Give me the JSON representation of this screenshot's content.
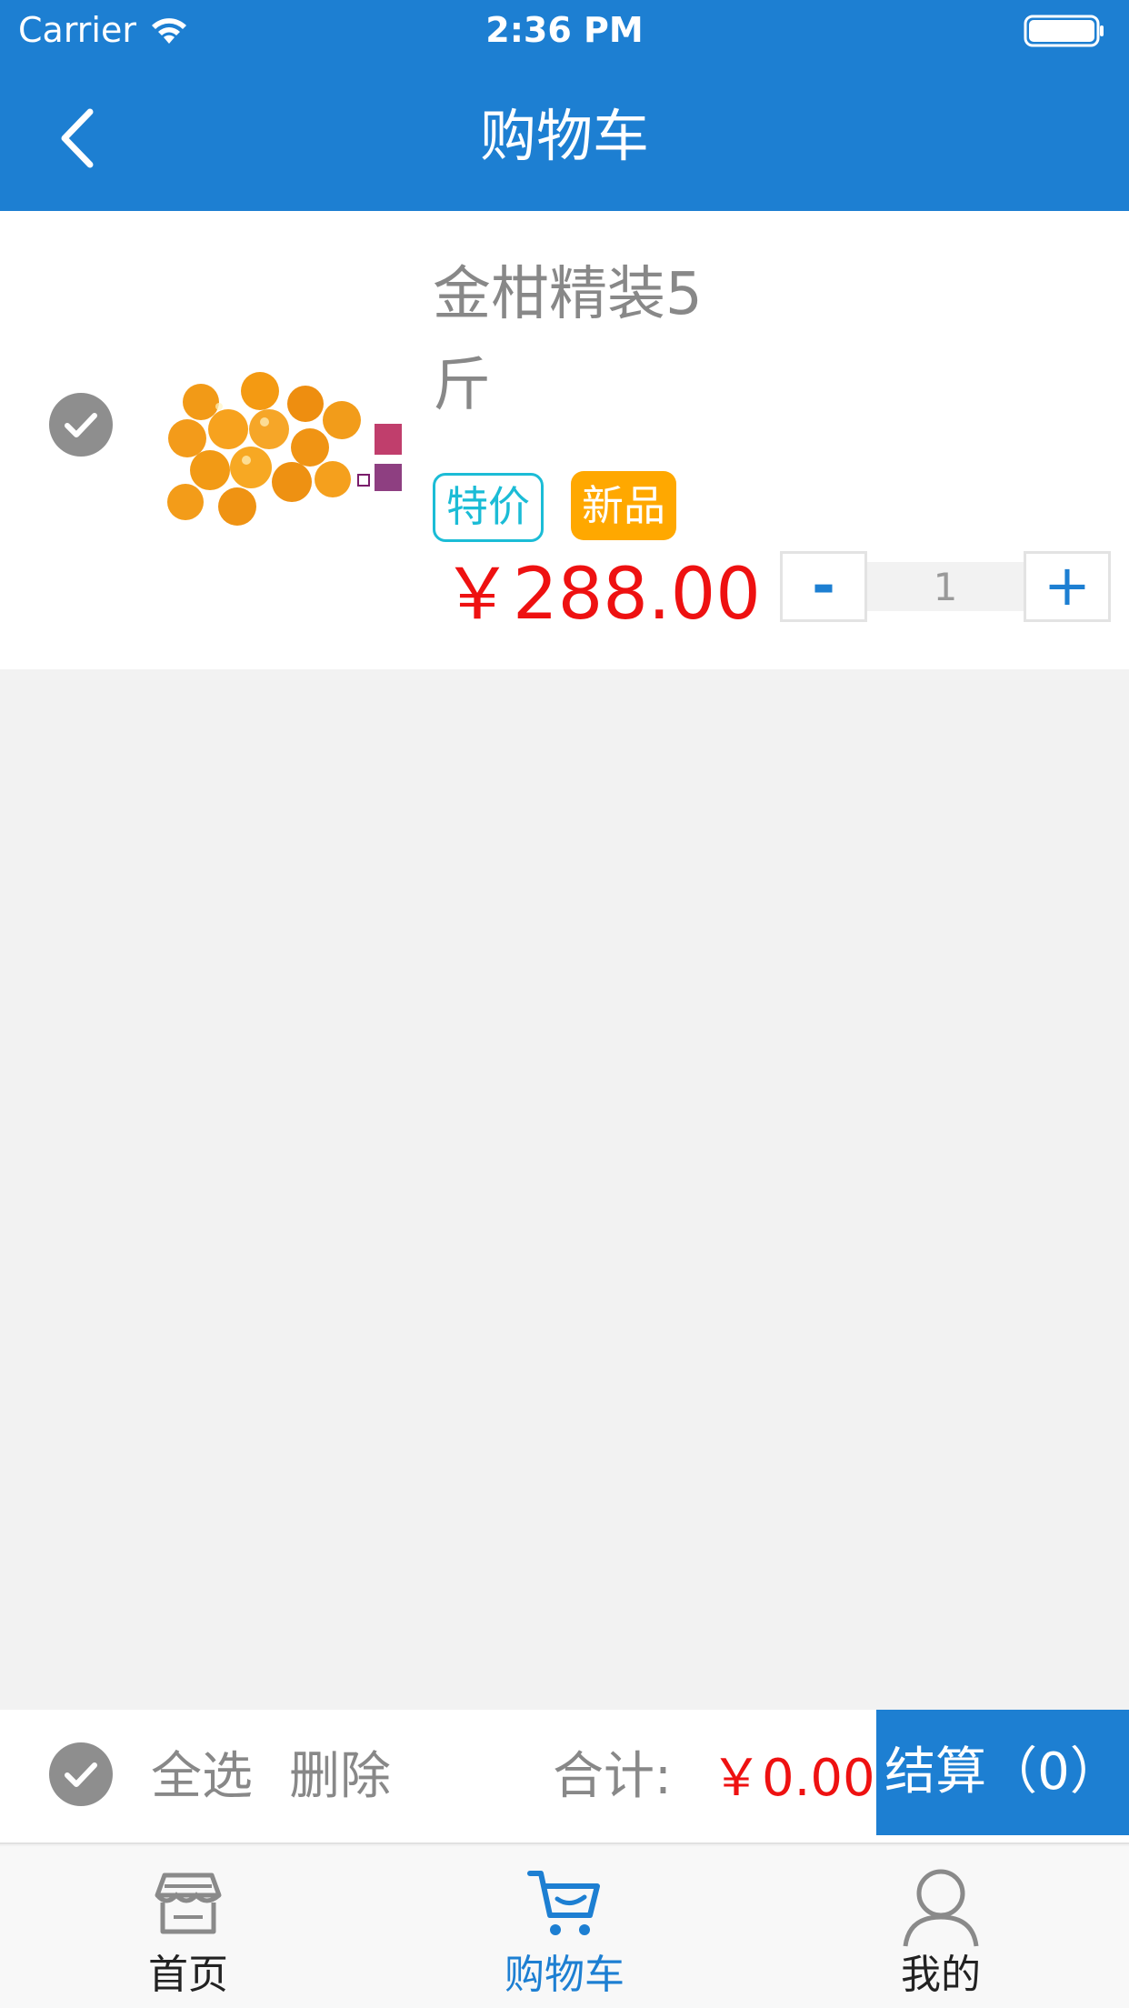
{
  "status_bar": {
    "carrier": "Carrier",
    "time": "2:36 PM"
  },
  "nav": {
    "title": "购物车",
    "back_icon": "chevron-left-icon"
  },
  "cart_item": {
    "name": "金柑精装5斤",
    "image_icon": "kumquat-product-image",
    "tags": [
      "特价",
      "新品"
    ],
    "price": "￥288.00",
    "quantity": "1",
    "minus_label": "-",
    "plus_label": "+"
  },
  "action_bar": {
    "select_all": "全选",
    "delete": "删除",
    "total_label": "合计:",
    "total_value": "￥0.00",
    "checkout": "结算（0）"
  },
  "tabs": [
    {
      "label": "首页",
      "icon": "store-icon",
      "active": false
    },
    {
      "label": "购物车",
      "icon": "cart-icon",
      "active": true
    },
    {
      "label": "我的",
      "icon": "user-icon",
      "active": false
    }
  ],
  "colors": {
    "primary": "#1d7fd2",
    "price": "#ee1111",
    "tag_special": "#1bbcd6",
    "tag_new": "#ffa800",
    "background": "#f2f2f2"
  }
}
